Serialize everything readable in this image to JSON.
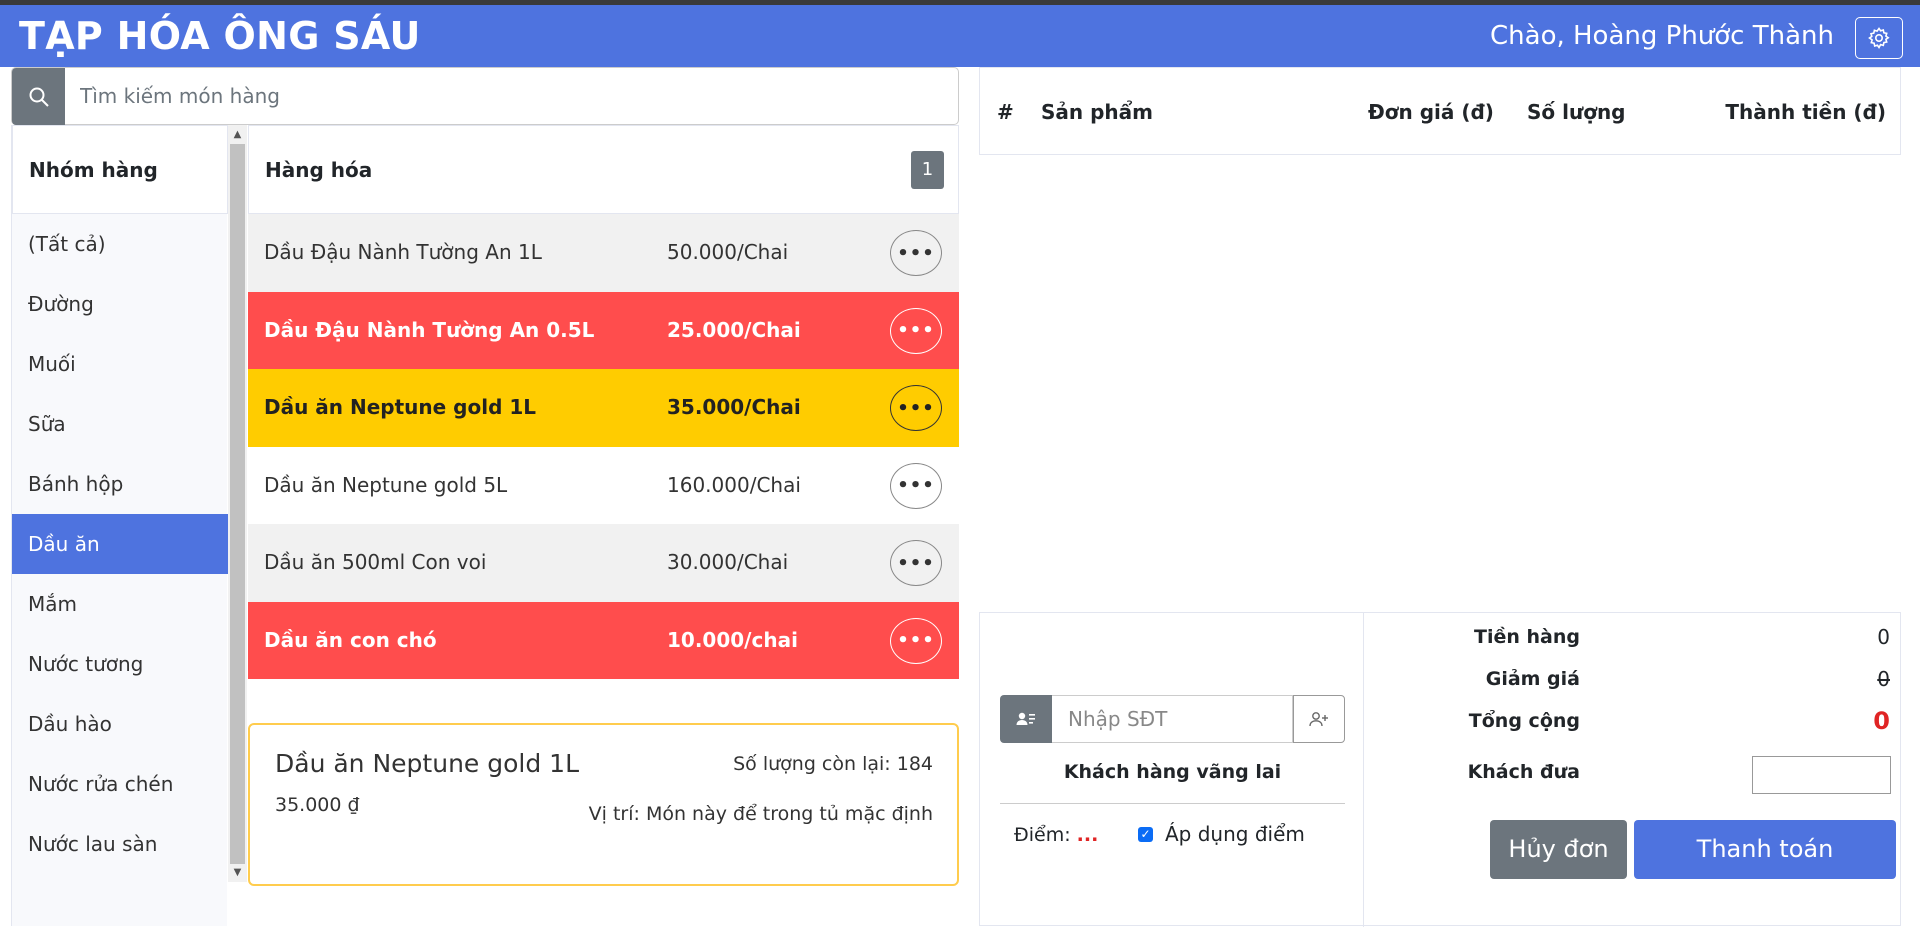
{
  "header": {
    "brand": "TẠP HÓA ÔNG SÁU",
    "greeting": "Chào, Hoàng Phước Thành"
  },
  "search": {
    "placeholder": "Tìm kiếm món hàng"
  },
  "categories": {
    "title": "Nhóm hàng",
    "items": [
      "(Tất cả)",
      "Đường",
      "Muối",
      "Sữa",
      "Bánh hộp",
      "Dầu ăn",
      "Mắm",
      "Nước tương",
      "Dầu hào",
      "Nước rửa chén",
      "Nước lau sàn"
    ],
    "active": "Dầu ăn"
  },
  "products": {
    "title": "Hàng hóa",
    "page": "1",
    "more_label": "•••",
    "rows": [
      {
        "name": "Dầu Đậu Nành Tường An 1L",
        "price": "50.000/Chai",
        "style": "grey"
      },
      {
        "name": "Dầu Đậu Nành Tường An 0.5L",
        "price": "25.000/Chai",
        "style": "red"
      },
      {
        "name": "Dầu ăn Neptune gold 1L",
        "price": "35.000/Chai",
        "style": "yellow"
      },
      {
        "name": "Dầu ăn Neptune gold 5L",
        "price": "160.000/Chai",
        "style": "white"
      },
      {
        "name": "Dầu ăn 500ml Con voi",
        "price": "30.000/Chai",
        "style": "grey"
      },
      {
        "name": "Dầu ăn con chó",
        "price": "10.000/chai",
        "style": "red"
      }
    ]
  },
  "detail": {
    "name": "Dầu ăn Neptune gold 1L",
    "stock": "Số lượng còn lại: 184",
    "price": "35.000 ₫",
    "location": "Vị trí: Món này để trong tủ mặc định"
  },
  "order_table": {
    "columns": [
      "#",
      "Sản phẩm",
      "Đơn giá (đ)",
      "Số lượng",
      "Thành tiền (đ)"
    ]
  },
  "customer": {
    "phone_placeholder": "Nhập SĐT",
    "name": "Khách hàng vãng lai",
    "points_label": "Điểm:",
    "points_value": "...",
    "apply_points_label": "Áp dụng điểm",
    "apply_points_checked": true
  },
  "summary": {
    "subtotal_label": "Tiền hàng",
    "subtotal_value": "0",
    "discount_label": "Giảm giá",
    "discount_value": "0",
    "total_label": "Tổng cộng",
    "total_value": "0",
    "paid_label": "Khách đưa"
  },
  "actions": {
    "cancel_label": "Hủy đơn",
    "pay_label": "Thanh toán"
  },
  "colors": {
    "primary": "#4e73df",
    "secondary": "#6c757d",
    "row_red": "#ff4d4d",
    "row_yellow": "#ffcc00",
    "total_red": "#e02424"
  }
}
